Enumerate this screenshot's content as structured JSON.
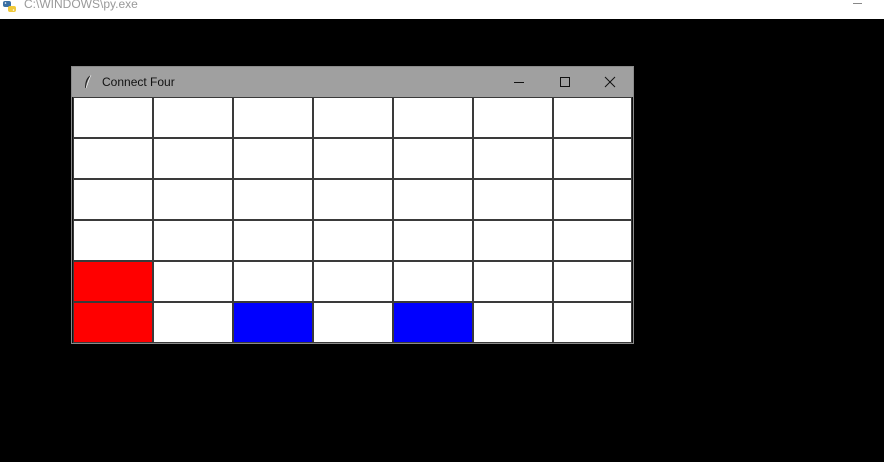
{
  "console": {
    "title": "C:\\WINDOWS\\py.exe"
  },
  "window": {
    "title": "Connect Four",
    "controls": [
      "minimize",
      "maximize",
      "close"
    ]
  },
  "board": {
    "rows": 6,
    "columns": 7,
    "empty_color": "#ffffff",
    "player_colors": {
      "red": "#ff0000",
      "blue": "#0000ff"
    },
    "cells": [
      [
        "empty",
        "empty",
        "empty",
        "empty",
        "empty",
        "empty",
        "empty"
      ],
      [
        "empty",
        "empty",
        "empty",
        "empty",
        "empty",
        "empty",
        "empty"
      ],
      [
        "empty",
        "empty",
        "empty",
        "empty",
        "empty",
        "empty",
        "empty"
      ],
      [
        "empty",
        "empty",
        "empty",
        "empty",
        "empty",
        "empty",
        "empty"
      ],
      [
        "red",
        "empty",
        "empty",
        "empty",
        "empty",
        "empty",
        "empty"
      ],
      [
        "red",
        "empty",
        "blue",
        "empty",
        "blue",
        "empty",
        "empty"
      ]
    ]
  }
}
